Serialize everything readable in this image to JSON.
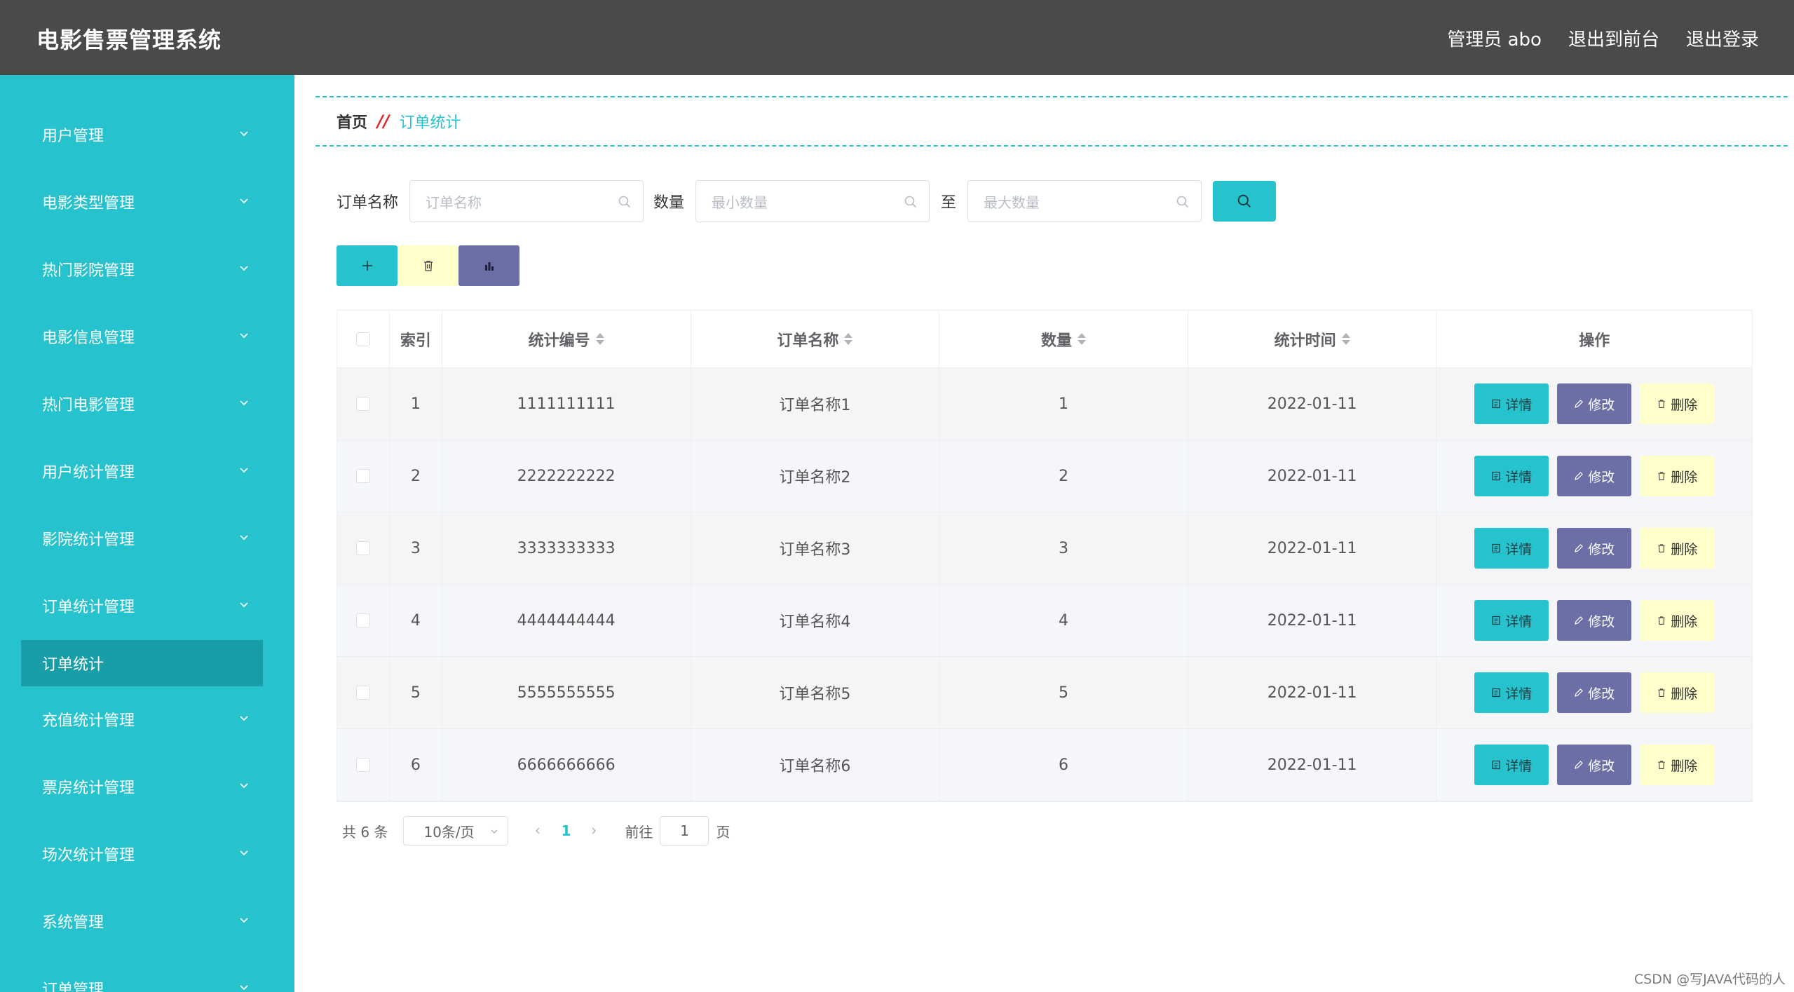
{
  "header": {
    "title": "电影售票管理系统",
    "links": [
      "管理员 abo",
      "退出到前台",
      "退出登录"
    ]
  },
  "sidebar": {
    "items": [
      {
        "label": "用户管理"
      },
      {
        "label": "电影类型管理"
      },
      {
        "label": "热门影院管理"
      },
      {
        "label": "电影信息管理"
      },
      {
        "label": "热门电影管理"
      },
      {
        "label": "用户统计管理"
      },
      {
        "label": "影院统计管理"
      },
      {
        "label": "订单统计管理"
      },
      {
        "label": "充值统计管理"
      },
      {
        "label": "票房统计管理"
      },
      {
        "label": "场次统计管理"
      },
      {
        "label": "系统管理"
      },
      {
        "label": "订单管理"
      }
    ],
    "active_sub": "订单统计"
  },
  "breadcrumb": {
    "home": "首页",
    "separator": "//",
    "current": "订单统计"
  },
  "search": {
    "name_label": "订单名称",
    "name_placeholder": "订单名称",
    "qty_label": "数量",
    "min_placeholder": "最小数量",
    "to_label": "至",
    "max_placeholder": "最大数量"
  },
  "toolbar": {
    "add_icon": "plus-icon",
    "delete_icon": "trash-icon",
    "chart_icon": "bar-chart-icon"
  },
  "table": {
    "headers": {
      "index": "索引",
      "code": "统计编号",
      "name": "订单名称",
      "qty": "数量",
      "time": "统计时间",
      "ops": "操作"
    },
    "rows": [
      {
        "index": "1",
        "code": "1111111111",
        "name": "订单名称1",
        "qty": "1",
        "time": "2022-01-11"
      },
      {
        "index": "2",
        "code": "2222222222",
        "name": "订单名称2",
        "qty": "2",
        "time": "2022-01-11"
      },
      {
        "index": "3",
        "code": "3333333333",
        "name": "订单名称3",
        "qty": "3",
        "time": "2022-01-11"
      },
      {
        "index": "4",
        "code": "4444444444",
        "name": "订单名称4",
        "qty": "4",
        "time": "2022-01-11"
      },
      {
        "index": "5",
        "code": "5555555555",
        "name": "订单名称5",
        "qty": "5",
        "time": "2022-01-11"
      },
      {
        "index": "6",
        "code": "6666666666",
        "name": "订单名称6",
        "qty": "6",
        "time": "2022-01-11"
      }
    ],
    "ops": {
      "detail": "详情",
      "edit": "修改",
      "del": "删除"
    }
  },
  "pagination": {
    "total": "共 6 条",
    "page_size": "10条/页",
    "current_page": "1",
    "goto_label": "前往",
    "goto_value": "1",
    "page_suffix": "页"
  },
  "watermark": "CSDN @写JAVA代码的人",
  "colors": {
    "accent": "#26c3cf",
    "header_bg": "#4a4a4a",
    "edit": "#6c6fa5",
    "delete": "#ffffcc",
    "separator": "#e0262a"
  }
}
